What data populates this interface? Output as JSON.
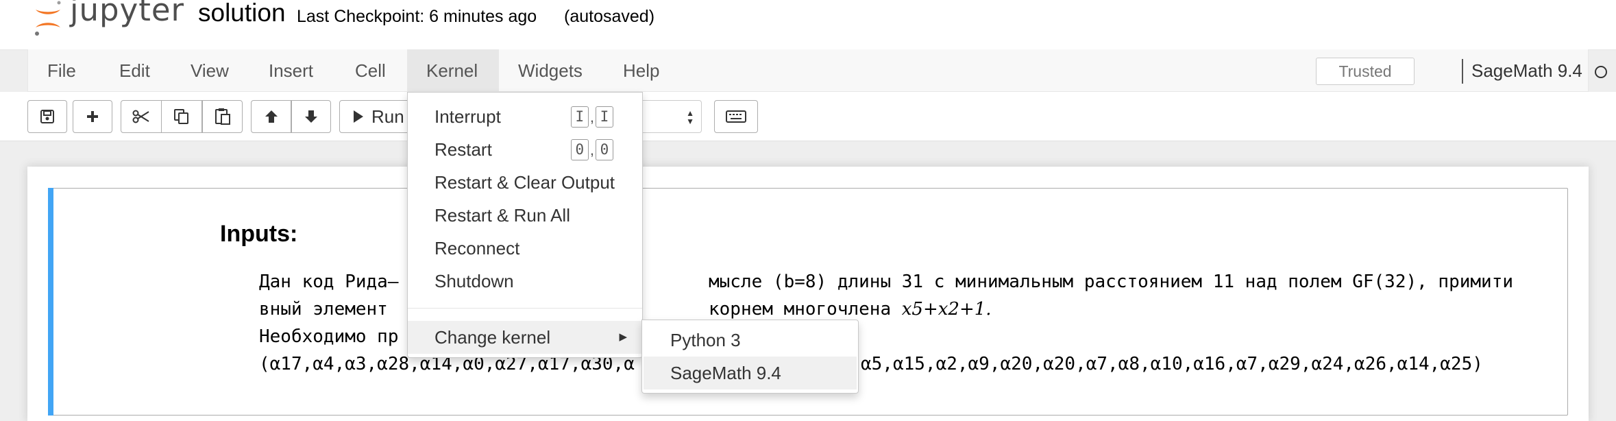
{
  "header": {
    "logo_text": "jupyter",
    "notebook_name": "solution",
    "checkpoint": "Last Checkpoint: 6 minutes ago",
    "autosave": "(autosaved)"
  },
  "menubar": {
    "items": [
      "File",
      "Edit",
      "View",
      "Insert",
      "Cell",
      "Kernel",
      "Widgets",
      "Help"
    ],
    "open_menu": "Kernel",
    "trusted": "Trusted",
    "kernel_name": "SageMath 9.4"
  },
  "toolbar": {
    "run_label": "Run",
    "buttons": [
      "save-icon",
      "plus-icon",
      "cut-icon",
      "copy-icon",
      "paste-icon",
      "arrow-up-icon",
      "arrow-down-icon",
      "run-icon",
      "keyboard-icon"
    ]
  },
  "cell": {
    "heading": "Inputs:",
    "line1": "Дан код Рида–",
    "line1_right": "мысле (b=8) длины 31 с минимальным расстоянием 11 над полем GF(32), примити",
    "line2_left": "вный элемент",
    "line2_right": "корнем многочлена ",
    "line2_poly": "x5+x2+1.",
    "line3_left": "Необходимо пр",
    "line4_left": "(α17,α4,α3,α28,α14,α0,α27,α17,α30,α",
    "line4_right": "α5,α15,α2,α9,α20,α20,α7,α8,α10,α16,α7,α29,α24,α26,α14,α25)"
  },
  "kernel_menu": {
    "interrupt": "Interrupt",
    "interrupt_keys": [
      "I",
      "I"
    ],
    "restart": "Restart",
    "restart_keys": [
      "0",
      "0"
    ],
    "restart_clear": "Restart & Clear Output",
    "restart_run": "Restart & Run All",
    "reconnect": "Reconnect",
    "shutdown": "Shutdown",
    "change_kernel": "Change kernel",
    "submenu": {
      "python3": "Python 3",
      "sagemath": "SageMath 9.4"
    }
  },
  "colors": {
    "cell_bar": "#42a5f5",
    "logo_orange": "#f37726",
    "menu_highlight": "#e7e7e7"
  }
}
